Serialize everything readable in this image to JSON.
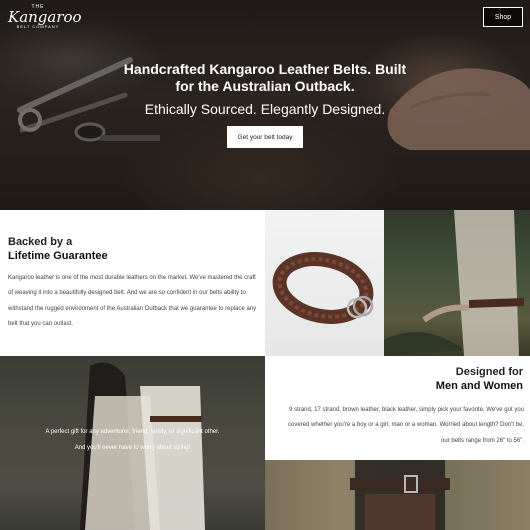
{
  "header": {
    "logo": {
      "top": "THE",
      "main": "Kangaroo",
      "sub": "BELT COMPANY"
    },
    "shop_label": "Shop"
  },
  "hero": {
    "title": "Handcrafted Kangaroo Leather Belts. Built for the Australian Outback.",
    "subtitle": "Ethically Sourced. Elegantly Designed.",
    "cta_label": "Get your belt today"
  },
  "guarantee": {
    "heading_line1": "Backed by a",
    "heading_line2": "Lifetime Guarantee",
    "body": "Kangaroo leather is one of the most durable leathers on the market. We've mastered the craft of weaving it into a beautifully designed belt. And we are so confident in our belts ability to withstand the rugged environment of the Australian Outback that we guarantee to replace any belt that you can outlast."
  },
  "gift": {
    "line1": "A perfect gift for any adventurer, friend, family, or significant other.",
    "line2": "And you'll never have to worry about sizing!"
  },
  "designed": {
    "heading_line1": "Designed for",
    "heading_line2": "Men and Women",
    "body": "9 strand, 17 strand, brown leather, black leather, simply pick your favorite. We've got you covered whether you're a boy or a girl, man or a woman. Worried about length? Don't be, our belts range from 26\" to 56\"."
  },
  "colors": {
    "accent": "#ffffff",
    "text": "#222222",
    "body_text": "#444444",
    "leather": "#5a3426"
  }
}
